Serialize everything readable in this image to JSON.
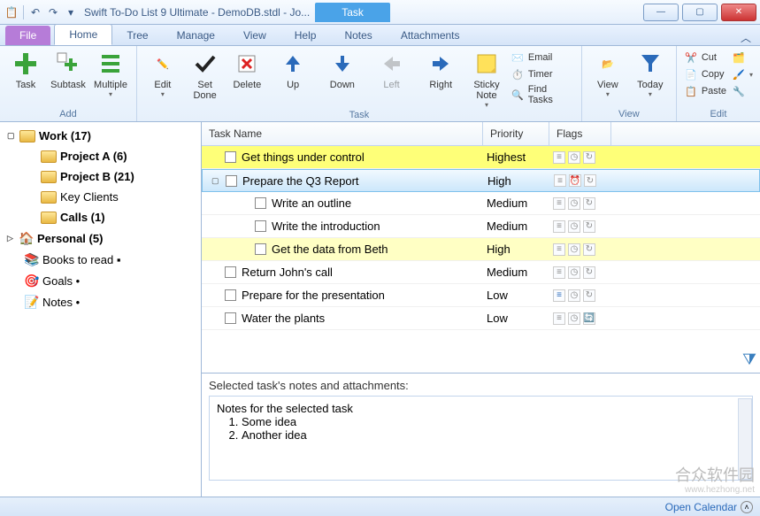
{
  "window": {
    "title": "Swift To-Do List 9 Ultimate - DemoDB.stdl - Jo...",
    "context_tab": "Task"
  },
  "tabs": {
    "file": "File",
    "items": [
      "Home",
      "Tree",
      "Manage",
      "View",
      "Help",
      "Notes",
      "Attachments"
    ],
    "active": 0
  },
  "ribbon": {
    "add": {
      "label": "Add",
      "task": "Task",
      "subtask": "Subtask",
      "multiple": "Multiple"
    },
    "task": {
      "label": "Task",
      "edit": "Edit",
      "setdone": "Set Done",
      "delete": "Delete",
      "up": "Up",
      "down": "Down",
      "left": "Left",
      "right": "Right",
      "sticky": "Sticky Note",
      "email": "Email",
      "timer": "Timer",
      "findtasks": "Find Tasks"
    },
    "view": {
      "label": "View",
      "view": "View",
      "today": "Today"
    },
    "edit": {
      "label": "Edit",
      "cut": "Cut",
      "copy": "Copy",
      "paste": "Paste"
    }
  },
  "tree": [
    {
      "label": "Work (17)",
      "bold": true,
      "icon": "folder",
      "expander": "▢",
      "indent": 0
    },
    {
      "label": "Project A (6)",
      "bold": true,
      "icon": "folder",
      "indent": 1
    },
    {
      "label": "Project B (21)",
      "bold": true,
      "icon": "folder",
      "indent": 1
    },
    {
      "label": "Key Clients",
      "bold": false,
      "icon": "folder-person",
      "indent": 1
    },
    {
      "label": "Calls (1)",
      "bold": true,
      "icon": "folder-person",
      "indent": 1
    },
    {
      "label": "Personal (5)",
      "bold": true,
      "icon": "home",
      "expander": "▷",
      "indent": 0
    },
    {
      "label": "Books to read ▪",
      "bold": false,
      "icon": "books",
      "indent": 0,
      "pad": true
    },
    {
      "label": "Goals •",
      "bold": false,
      "icon": "target",
      "indent": 0,
      "pad": true
    },
    {
      "label": "Notes •",
      "bold": false,
      "icon": "note",
      "indent": 0,
      "pad": true
    }
  ],
  "grid": {
    "headers": {
      "name": "Task Name",
      "priority": "Priority",
      "flags": "Flags"
    },
    "rows": [
      {
        "name": "Get things under control",
        "priority": "Highest",
        "hl": "yellow",
        "child": false,
        "expander": ""
      },
      {
        "name": "Prepare the Q3 Report",
        "priority": "High",
        "hl": "blue",
        "child": false,
        "expander": "▢",
        "clock": true
      },
      {
        "name": "Write an outline",
        "priority": "Medium",
        "hl": "",
        "child": true
      },
      {
        "name": "Write the introduction",
        "priority": "Medium",
        "hl": "",
        "child": true
      },
      {
        "name": "Get the data from Beth",
        "priority": "High",
        "hl": "lightyellow",
        "child": true
      },
      {
        "name": "Return John's call",
        "priority": "Medium",
        "hl": "",
        "child": false
      },
      {
        "name": "Prepare for the presentation",
        "priority": "Low",
        "hl": "",
        "child": false,
        "blueflag": true
      },
      {
        "name": "Water the plants",
        "priority": "Low",
        "hl": "",
        "child": false,
        "recur": true
      }
    ]
  },
  "notes": {
    "label": "Selected task's notes and attachments:",
    "title": "Notes for the selected task",
    "items": [
      "Some idea",
      "Another idea"
    ]
  },
  "statusbar": {
    "link": "Open Calendar"
  },
  "watermark": {
    "big": "合众软件园",
    "small": "www.hezhong.net"
  }
}
